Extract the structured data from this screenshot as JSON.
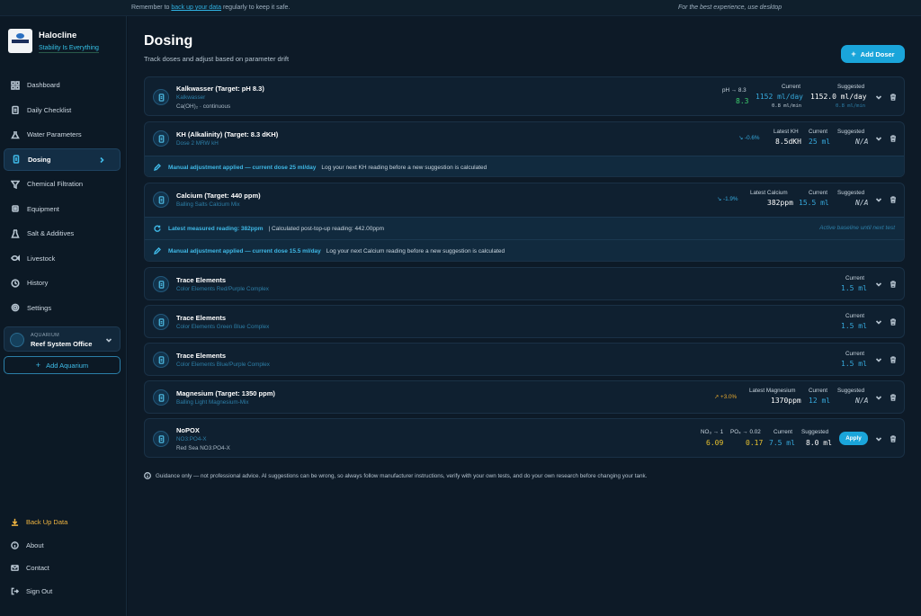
{
  "banner": {
    "left_pre": "Remember to ",
    "left_link": "back up your data",
    "left_post": " regularly to keep it safe.",
    "right": "For the best experience, use desktop"
  },
  "brand": {
    "name": "Halocline",
    "tagline": "Stability Is Everything"
  },
  "nav": [
    {
      "label": "Dashboard",
      "icon": "grid-icon"
    },
    {
      "label": "Daily Checklist",
      "icon": "clipboard-icon"
    },
    {
      "label": "Water Parameters",
      "icon": "flask-icon"
    },
    {
      "label": "Dosing",
      "icon": "doser-icon",
      "active": true
    },
    {
      "label": "Chemical Filtration",
      "icon": "filter-icon"
    },
    {
      "label": "Equipment",
      "icon": "chip-icon"
    },
    {
      "label": "Salt & Additives",
      "icon": "beaker-icon"
    },
    {
      "label": "Livestock",
      "icon": "fish-icon"
    },
    {
      "label": "History",
      "icon": "history-icon"
    },
    {
      "label": "Settings",
      "icon": "gear-icon"
    }
  ],
  "aquarium": {
    "label": "AQUARIUM",
    "name": "Reef System Office",
    "add_label": "Add Aquarium"
  },
  "footer_nav": [
    {
      "label": "Back Up Data",
      "icon": "download-icon"
    },
    {
      "label": "About",
      "icon": "info-icon"
    },
    {
      "label": "Contact",
      "icon": "mail-icon"
    },
    {
      "label": "Sign Out",
      "icon": "logout-icon"
    }
  ],
  "page": {
    "title": "Dosing",
    "subtitle": "Track doses and adjust based on parameter drift",
    "add_doser": "Add Doser"
  },
  "labels": {
    "current": "Current",
    "suggested": "Suggested",
    "latest_kh": "Latest KH",
    "latest_calcium": "Latest Calcium",
    "latest_magnesium": "Latest Magnesium",
    "apply": "Apply",
    "na": "N/A"
  },
  "cards": {
    "kalk": {
      "name": "Kalkwasser (Target: pH 8.3)",
      "sub": "Kalkwasser",
      "sub2": "Ca(OH)₂ · continuous",
      "ph_label": "pH → 8.3",
      "ph_value": "8.3",
      "current": "1152 ml/day",
      "current_rate": "0.8 ml/min",
      "suggested": "1152.0 ml/day",
      "suggested_rate": "0.8 ml/min"
    },
    "kh": {
      "name": "KH (Alkalinity) (Target: 8.3 dKH)",
      "sub": "Dose 2 MRW kH",
      "trend": "↘ -0.6%",
      "latest": "8.5dKH",
      "current": "25 ml",
      "band_hl": "Manual adjustment applied — current dose 25 ml/day",
      "band_tx": "Log your next KH reading before a new suggestion is calculated"
    },
    "calcium": {
      "name": "Calcium (Target: 440 ppm)",
      "sub": "Balling Salts Calcium Mix",
      "trend": "↘ -1.9%",
      "latest": "382ppm",
      "current": "15.5 ml",
      "band1_hl": "Latest measured reading: 382ppm",
      "band1_tx": "| Calculated post-top-up reading: 442.00ppm",
      "band1_rt": "Active baseline until next test",
      "band2_hl": "Manual adjustment applied — current dose 15.5 ml/day",
      "band2_tx": "Log your next Calcium reading before a new suggestion is calculated"
    },
    "trace1": {
      "name": "Trace Elements",
      "sub": "Color Elements Red/Purple Complex",
      "current": "1.5 ml"
    },
    "trace2": {
      "name": "Trace Elements",
      "sub": "Color Elements Green Blue Complex",
      "current": "1.5 ml"
    },
    "trace3": {
      "name": "Trace Elements",
      "sub": "Color Elements Blue/Purple Complex",
      "current": "1.5 ml"
    },
    "magnesium": {
      "name": "Magnesium (Target: 1350 ppm)",
      "sub": "Balling Light Magnesium-Mix",
      "trend": "↗ +3.0%",
      "latest": "1370ppm",
      "current": "12 ml"
    },
    "nopox": {
      "name": "NoPOX",
      "sub": "NO3:PO4-X",
      "sub2": "Red Sea NO3:PO4-X",
      "no3_label": "NO₃ → 1",
      "no3_value": "6.09",
      "po4_label": "PO₄ → 0.02",
      "po4_value": "0.17",
      "current": "7.5 ml",
      "suggested": "8.0 ml"
    }
  },
  "disclaimer": "Guidance only — not professional advice. AI suggestions can be wrong, so always follow manufacturer instructions, verify with your own tests, and do your own research before changing your tank."
}
